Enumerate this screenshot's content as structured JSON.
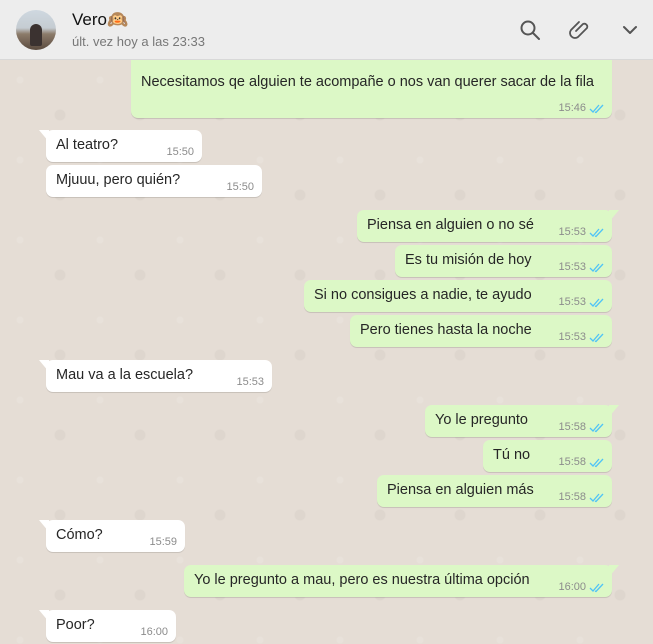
{
  "header": {
    "name": "Vero🙉",
    "status": "últ. vez hoy a las 23:33",
    "icons": [
      "search-icon",
      "paperclip-icon",
      "chevron-down-icon"
    ]
  },
  "colors": {
    "incoming": "#ffffff",
    "outgoing": "#dcf8c6",
    "read_ticks": "#4fc3f7",
    "header": "#ededed",
    "chat_bg": "#e5ddd5"
  },
  "messages": [
    {
      "dir": "out",
      "text": "Necesitamos qe alguien te acompañe o nos van querer sacar de la fila",
      "time": "15:46"
    },
    {
      "dir": "in",
      "text": "Al teatro?",
      "time": "15:50"
    },
    {
      "dir": "in",
      "text": "Mjuuu, pero quién?",
      "time": "15:50"
    },
    {
      "dir": "out",
      "text": "Piensa en alguien o no sé",
      "time": "15:53"
    },
    {
      "dir": "out",
      "text": "Es tu misión de hoy",
      "time": "15:53"
    },
    {
      "dir": "out",
      "text": "Si no consigues a nadie, te ayudo",
      "time": "15:53"
    },
    {
      "dir": "out",
      "text": "Pero tienes hasta la noche",
      "time": "15:53"
    },
    {
      "dir": "in",
      "text": "Mau va a la escuela?",
      "time": "15:53"
    },
    {
      "dir": "out",
      "text": "Yo le pregunto",
      "time": "15:58"
    },
    {
      "dir": "out",
      "text": "Tú no",
      "time": "15:58"
    },
    {
      "dir": "out",
      "text": "Piensa en alguien más",
      "time": "15:58"
    },
    {
      "dir": "in",
      "text": "Cómo?",
      "time": "15:59"
    },
    {
      "dir": "out",
      "text": "Yo le pregunto a mau, pero es nuestra última opción",
      "time": "16:00"
    },
    {
      "dir": "in",
      "text": "Poor?",
      "time": "16:00"
    }
  ]
}
